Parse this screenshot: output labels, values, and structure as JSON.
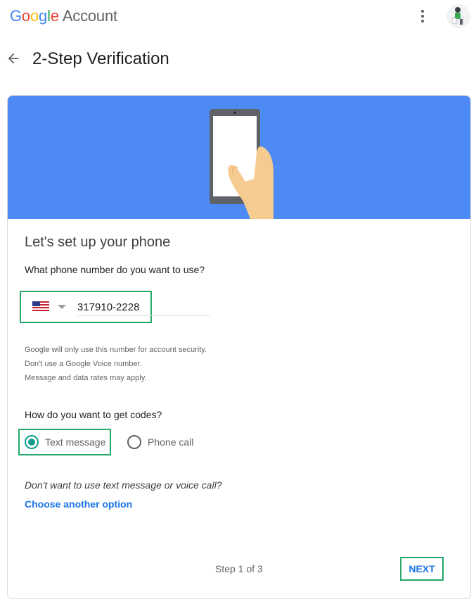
{
  "header": {
    "logo_letters": [
      "G",
      "o",
      "o",
      "g",
      "l",
      "e"
    ],
    "logo_suffix": "Account",
    "more_icon": "vertical-dots-icon",
    "avatar_icon": "user-avatar"
  },
  "page": {
    "back_icon": "arrow-left-icon",
    "title": "2-Step Verification"
  },
  "card": {
    "hero_icon": "hand-holding-phone-illustration",
    "title": "Let's set up your phone",
    "phone_question": "What phone number do you want to use?",
    "country_flag_icon": "us-flag-icon",
    "phone_value": "317910-2228",
    "notes": [
      "Google will only use this number for account security.",
      "Don't use a Google Voice number.",
      "Message and data rates may apply."
    ],
    "codes_question": "How do you want to get codes?",
    "options": [
      {
        "label": "Text message",
        "selected": true
      },
      {
        "label": "Phone call",
        "selected": false
      }
    ],
    "alt_question": "Don't want to use text message or voice call?",
    "alt_link": "Choose another option",
    "step": "Step 1 of 3",
    "next_label": "NEXT"
  },
  "colors": {
    "hero_bg": "#4e8af4",
    "highlight": "#26a96a",
    "link": "#1a73e8",
    "radio_selected": "#129e8d"
  }
}
